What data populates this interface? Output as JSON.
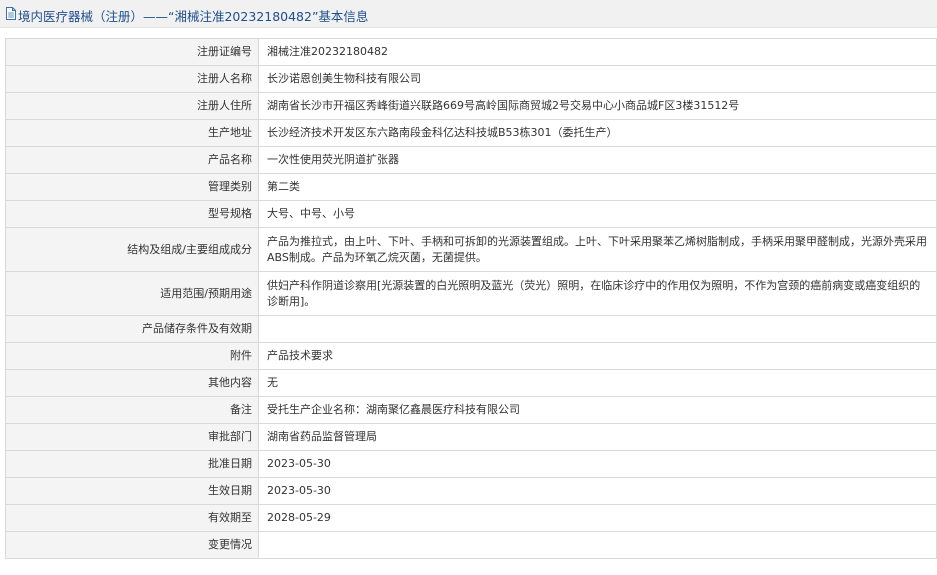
{
  "header": {
    "title": "境内医疗器械（注册）——“湘械注准20232180482”基本信息",
    "icon": "document-icon"
  },
  "fields": [
    {
      "key": "注册证编号",
      "value": "湘械注准20232180482"
    },
    {
      "key": "注册人名称",
      "value": "长沙诺恩创美生物科技有限公司"
    },
    {
      "key": "注册人住所",
      "value": "湖南省长沙市开福区秀峰街道兴联路669号高岭国际商贸城2号交易中心小商品城F区3楼31512号"
    },
    {
      "key": "生产地址",
      "value": "长沙经济技术开发区东六路南段金科亿达科技城B53栋301（委托生产）"
    },
    {
      "key": "产品名称",
      "value": "一次性使用荧光阴道扩张器"
    },
    {
      "key": "管理类别",
      "value": "第二类"
    },
    {
      "key": "型号规格",
      "value": "大号、中号、小号"
    },
    {
      "key": "结构及组成/主要组成成分",
      "value": "产品为推拉式，由上叶、下叶、手柄和可拆卸的光源装置组成。上叶、下叶采用聚苯乙烯树脂制成，手柄采用聚甲醛制成，光源外壳采用ABS制成。产品为环氧乙烷灭菌，无菌提供。"
    },
    {
      "key": "适用范围/预期用途",
      "value": "供妇产科作阴道诊察用[光源装置的白光照明及蓝光（荧光）照明，在临床诊疗中的作用仅为照明，不作为宫颈的癌前病变或癌变组织的诊断用]。"
    },
    {
      "key": "产品储存条件及有效期",
      "value": ""
    },
    {
      "key": "附件",
      "value": "产品技术要求"
    },
    {
      "key": "其他内容",
      "value": "无"
    },
    {
      "key": "备注",
      "value": "受托生产企业名称：湖南聚亿鑫晨医疗科技有限公司"
    },
    {
      "key": "审批部门",
      "value": "湖南省药品监督管理局"
    },
    {
      "key": "批准日期",
      "value": "2023-05-30"
    },
    {
      "key": "生效日期",
      "value": "2023-05-30"
    },
    {
      "key": "有效期至",
      "value": "2028-05-29"
    },
    {
      "key": "变更情况",
      "value": ""
    }
  ]
}
